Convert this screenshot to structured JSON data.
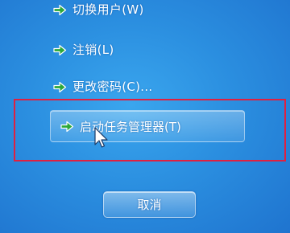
{
  "menu": {
    "items": [
      {
        "label": "切换用户(W)",
        "icon": "arrow-right-icon"
      },
      {
        "label": "注销(L)",
        "icon": "arrow-right-icon"
      },
      {
        "label": "更改密码(C)...",
        "icon": "arrow-right-icon"
      }
    ],
    "task_manager": {
      "label": "启动任务管理器(T)",
      "icon": "arrow-right-icon"
    }
  },
  "cancel": {
    "label": "取消"
  },
  "colors": {
    "background": "#2b8fe0",
    "arrow": "#2ca83a",
    "highlight": "#e02040",
    "text": "#ffffff"
  }
}
